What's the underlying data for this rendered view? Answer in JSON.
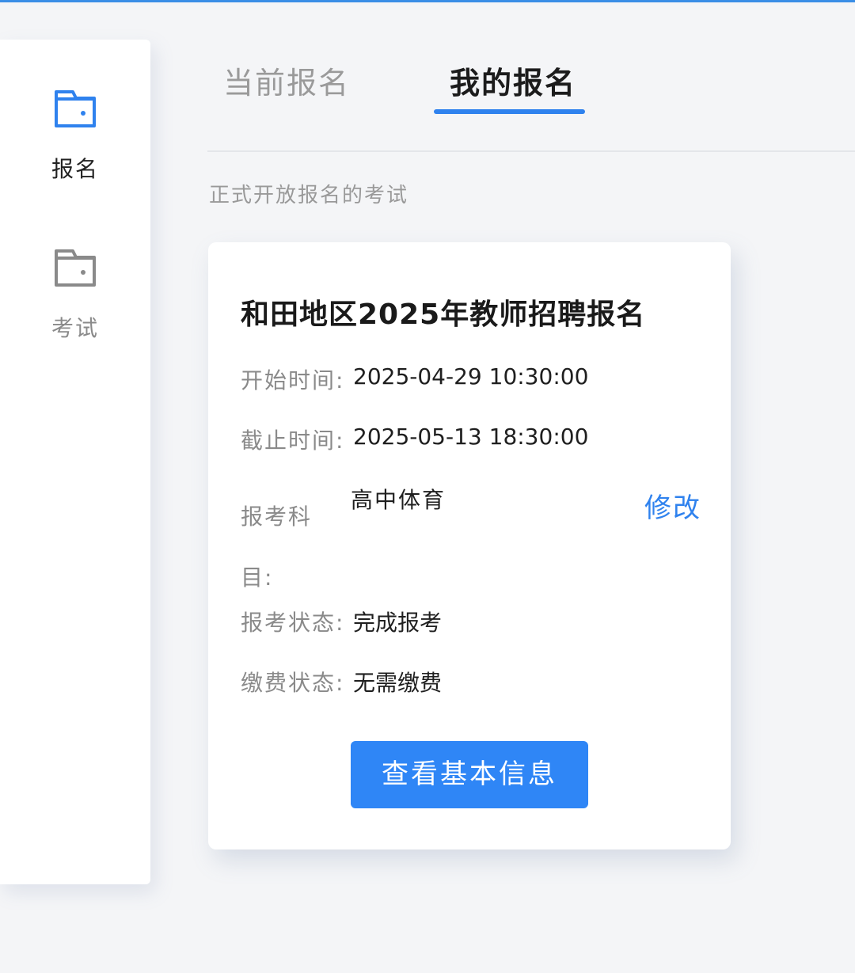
{
  "sidebar": {
    "items": [
      {
        "label": "报名",
        "icon": "folder-icon",
        "active": true,
        "color": "#2f82ee"
      },
      {
        "label": "考试",
        "icon": "folder-icon",
        "active": false,
        "color": "#8a8a8a"
      }
    ]
  },
  "tabs": [
    {
      "label": "当前报名",
      "active": false
    },
    {
      "label": "我的报名",
      "active": true
    }
  ],
  "section_caption": "正式开放报名的考试",
  "card": {
    "title": "和田地区2025年教师招聘报名",
    "start_label": "开始时间:",
    "start_value": "2025-04-29 10:30:00",
    "end_label": "截止时间:",
    "end_value": "2025-05-13 18:30:00",
    "subject_label": "报考科目:",
    "subject_value": "高中体育",
    "edit_label": "修改",
    "apply_status_label": "报考状态:",
    "apply_status_value": "完成报考",
    "payment_status_label": "缴费状态:",
    "payment_status_value": "无需缴费",
    "button_label": "查看基本信息"
  },
  "colors": {
    "accent": "#2f82ee",
    "button": "#2f86f6",
    "background": "#f4f5f7"
  }
}
